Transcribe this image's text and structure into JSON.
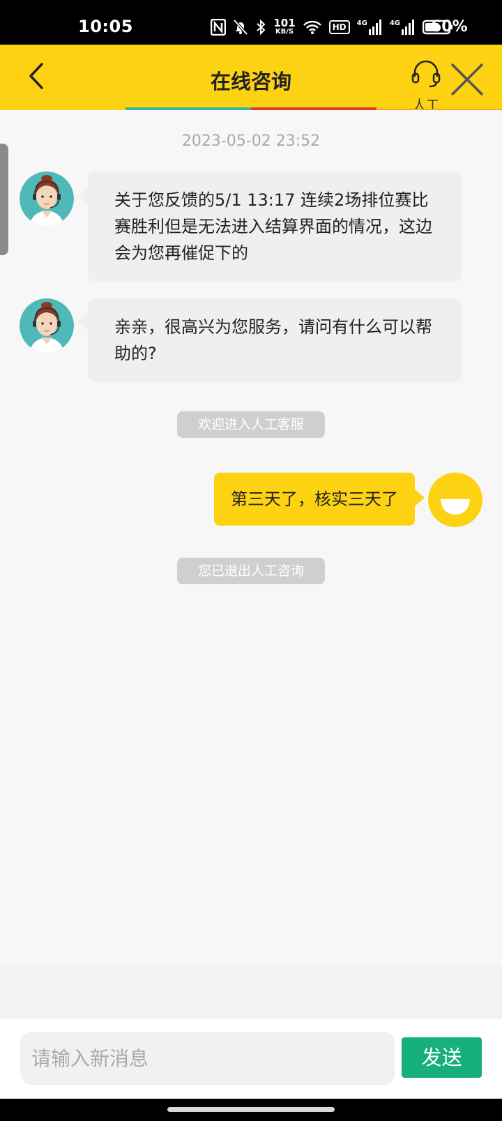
{
  "status_bar": {
    "time": "10:05",
    "net_speed_value": "101",
    "net_speed_unit": "KB/S",
    "hd_label": "HD",
    "signal_1_label": "4G",
    "signal_2_label": "4G",
    "battery_text": "60%",
    "battery_level": 0.6,
    "icons": [
      "nfc-icon",
      "mute-bell-icon",
      "bluetooth-icon",
      "wifi-icon",
      "hd-voice-icon",
      "signal-icon",
      "signal-icon",
      "battery-icon"
    ]
  },
  "header": {
    "title": "在线咨询",
    "human_service_label": "人工",
    "colors": {
      "background": "#fdd213",
      "line_teal": "#39b5a8",
      "line_red": "#e23a2a",
      "line_orange": "#f5a623"
    }
  },
  "chat": {
    "timestamp": "2023-05-02 23:52",
    "messages": [
      {
        "sender": "agent",
        "text": "关于您反馈的5/1 13:17 连续2场排位赛比赛胜利但是无法进入结算界面的情况，这边会为您再催促下的"
      },
      {
        "sender": "agent",
        "text": "亲亲，很高兴为您服务，请问有什么可以帮助的?"
      },
      {
        "sender": "system",
        "text": "欢迎进入人工客服"
      },
      {
        "sender": "user",
        "text": "第三天了，核实三天了"
      },
      {
        "sender": "system",
        "text": "您已退出人工咨询"
      }
    ]
  },
  "input_bar": {
    "placeholder": "请输入新消息",
    "value": "",
    "send_label": "发送",
    "send_color": "#16b07c"
  }
}
